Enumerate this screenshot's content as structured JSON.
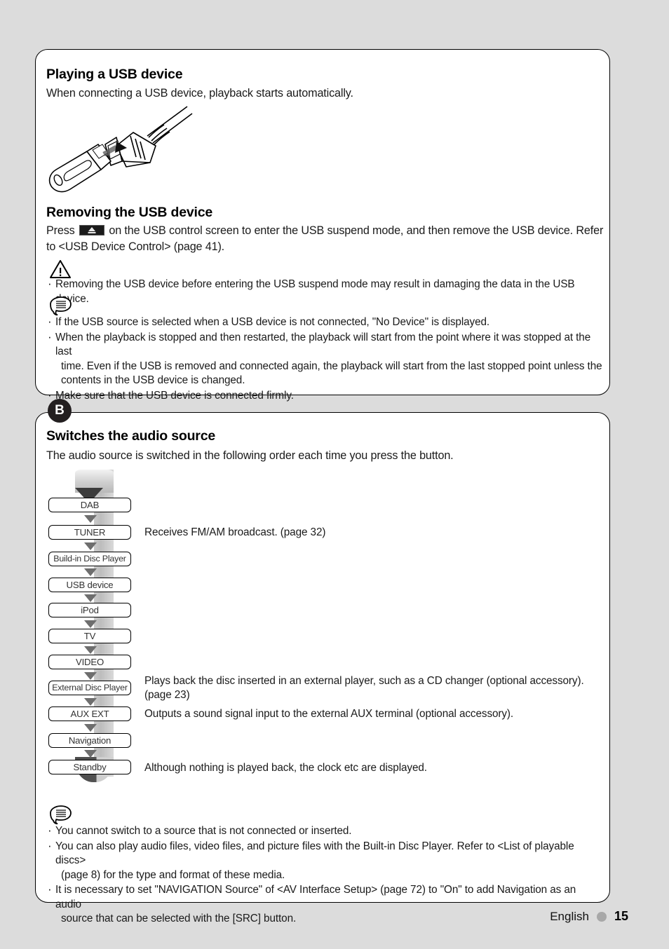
{
  "page": {
    "background": "#dcdcdc",
    "panel_background": "#ffffff"
  },
  "section_usb": {
    "title": "Playing a USB device",
    "lead": "When connecting a USB device, playback starts automatically.",
    "illustration_name": "usb-flash-drive-connecting-to-cable-illustration",
    "removing_title": "Removing the USB device",
    "removing_text_before": "Press",
    "removing_icon": "eject-button-icon",
    "removing_text_after": "on the USB control screen to enter the USB suspend mode, and then remove the USB device. Refer to <USB Device Control> (page 41).",
    "warning_icon": "warning-triangle-icon",
    "warning_bullets": [
      "Removing the USB device before entering the USB suspend mode may result in damaging the data in the USB device."
    ],
    "note_icon": "note-speech-bubble-icon",
    "note_bullets": [
      {
        "line1": "If the USB source is selected when a USB device is not connected, \"No Device\" is displayed.",
        "line2": "",
        "line3": ""
      },
      {
        "line1": "When the playback is stopped and then restarted, the playback will start from the point where it was stopped at the last",
        "line2": "time. Even if the USB is removed and connected again, the playback will start from the last stopped point unless the",
        "line3": "contents in the USB device is changed."
      },
      {
        "line1": "Make sure that the USB device is connected firmly.",
        "line2": "",
        "line3": ""
      }
    ]
  },
  "section_source": {
    "badge": "B",
    "title": "Switches the audio source",
    "lead": "The audio source is switched in the following order each time you press the button.",
    "flow": {
      "nodes": [
        {
          "label": "DAB",
          "desc_line1": "",
          "desc_line2": ""
        },
        {
          "label": "TUNER",
          "desc_line1": "Receives FM/AM broadcast. (page 32)",
          "desc_line2": ""
        },
        {
          "label": "Build-in Disc Player",
          "desc_line1": "",
          "desc_line2": ""
        },
        {
          "label": "USB device",
          "desc_line1": "",
          "desc_line2": ""
        },
        {
          "label": "iPod",
          "desc_line1": "",
          "desc_line2": ""
        },
        {
          "label": "TV",
          "desc_line1": "",
          "desc_line2": ""
        },
        {
          "label": "VIDEO",
          "desc_line1": "",
          "desc_line2": ""
        },
        {
          "label": "External Disc Player",
          "desc_line1": "Plays back the disc inserted in an external player, such as a CD changer (optional accessory).",
          "desc_line2": "(page 23)"
        },
        {
          "label": "AUX EXT",
          "desc_line1": "Outputs a sound signal input to the external AUX terminal (optional accessory).",
          "desc_line2": ""
        },
        {
          "label": "Navigation",
          "desc_line1": "",
          "desc_line2": ""
        },
        {
          "label": "Standby",
          "desc_line1": "Although nothing is played back, the clock etc are displayed.",
          "desc_line2": ""
        }
      ]
    },
    "note_icon": "note-speech-bubble-icon",
    "note_bullets": [
      {
        "line1": "You cannot switch to a source that is not connected or inserted.",
        "line2": ""
      },
      {
        "line1": "You can also play audio files, video files, and picture files with the Built-in Disc Player. Refer to <List of playable discs>",
        "line2": "(page 8) for the type and format of these media."
      },
      {
        "line1": "It is necessary to set \"NAVIGATION Source\" of <AV Interface Setup> (page 72) to \"On\" to add Navigation as an audio",
        "line2": "source that can be selected with the [SRC] button."
      }
    ]
  },
  "footer": {
    "language": "English",
    "page_number": "15"
  }
}
